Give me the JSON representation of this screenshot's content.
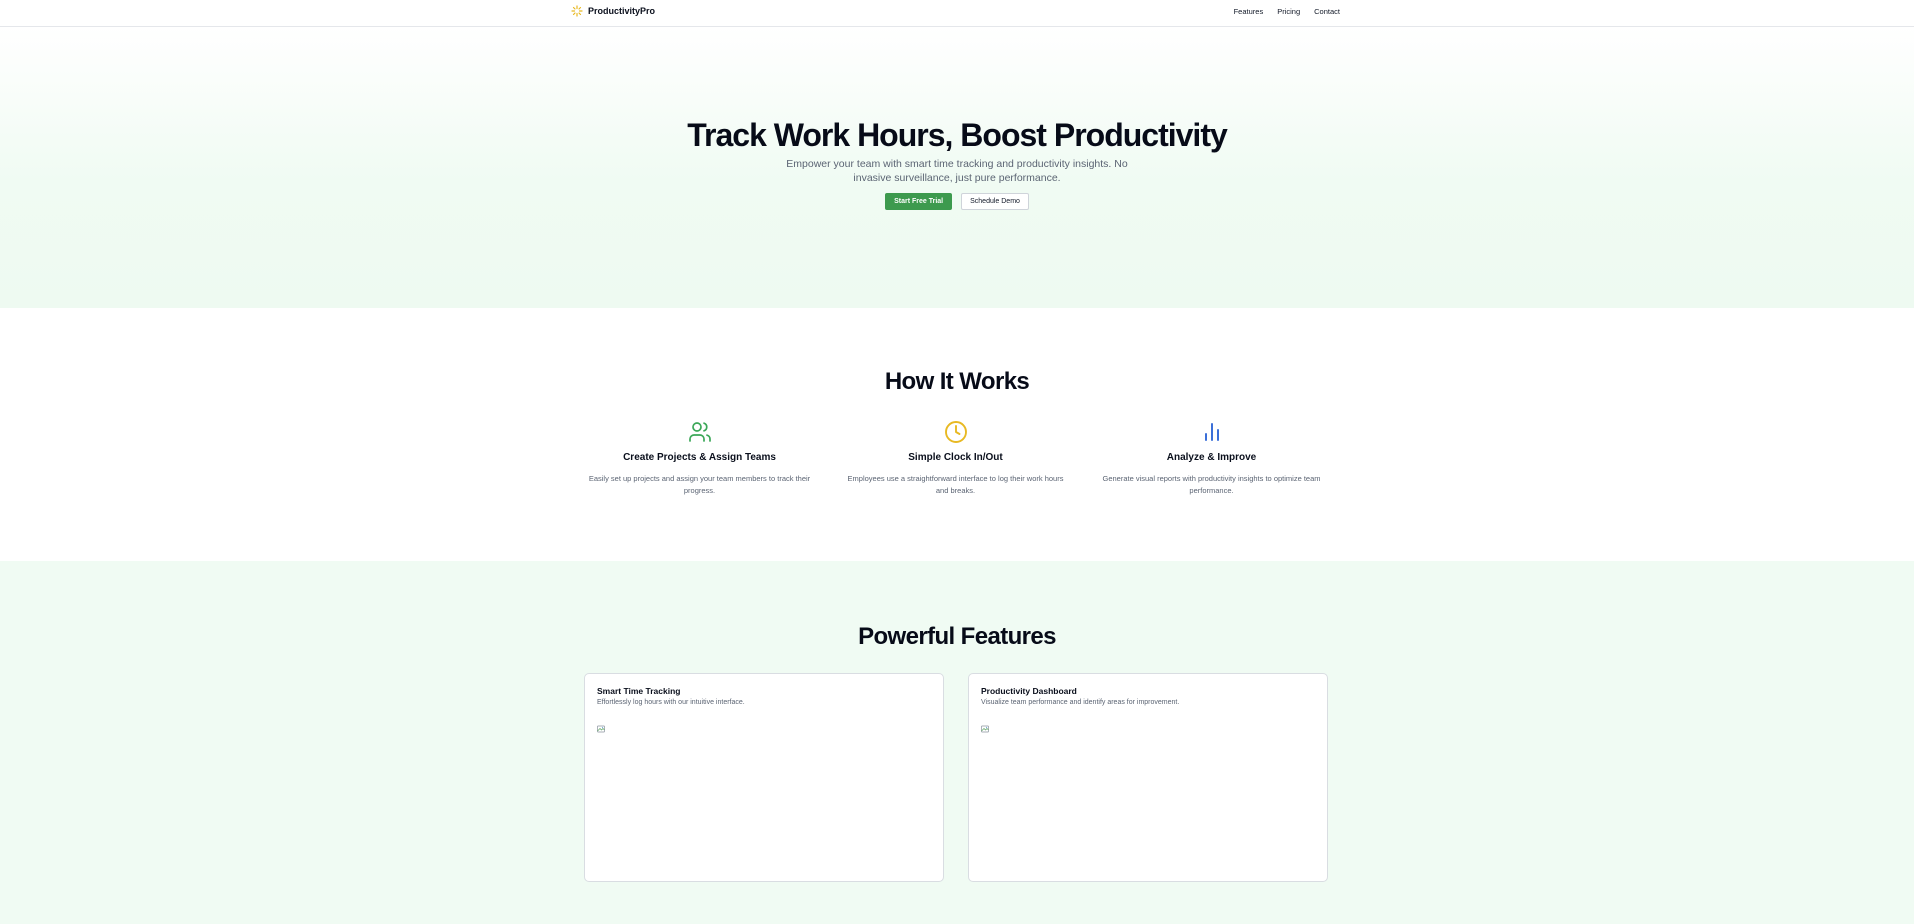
{
  "brand": {
    "name": "ProductivityPro",
    "logo_icon": "sun-icon",
    "accent_color": "#e8b923"
  },
  "nav": {
    "items": [
      "Features",
      "Pricing",
      "Contact"
    ]
  },
  "hero": {
    "title": "Track Work Hours, Boost Productivity",
    "subtitle": "Empower your team with smart time tracking and productivity insights. No invasive surveillance, just pure performance.",
    "primary_cta": "Start Free Trial",
    "secondary_cta": "Schedule Demo"
  },
  "how_it_works": {
    "heading": "How It Works",
    "steps": [
      {
        "icon": "users-icon",
        "icon_color": "#3aa757",
        "title": "Create Projects & Assign Teams",
        "text": "Easily set up projects and assign your team members to track their progress."
      },
      {
        "icon": "clock-icon",
        "icon_color": "#e8b923",
        "title": "Simple Clock In/Out",
        "text": "Employees use a straightforward interface to log their work hours and breaks."
      },
      {
        "icon": "bar-chart-icon",
        "icon_color": "#3b6fd8",
        "title": "Analyze & Improve",
        "text": "Generate visual reports with productivity insights to optimize team performance."
      }
    ]
  },
  "features": {
    "heading": "Powerful Features",
    "cards": [
      {
        "title": "Smart Time Tracking",
        "text": "Effortlessly log hours with our intuitive interface.",
        "image_icon": "broken-image-icon"
      },
      {
        "title": "Productivity Dashboard",
        "text": "Visualize team performance and identify areas for improvement.",
        "image_icon": "broken-image-icon"
      }
    ]
  },
  "colors": {
    "primary_green": "#3d9a4e",
    "hero_bg": "#f0fbf3",
    "text_dark": "#0a0f1c",
    "text_muted": "#5b6473"
  }
}
